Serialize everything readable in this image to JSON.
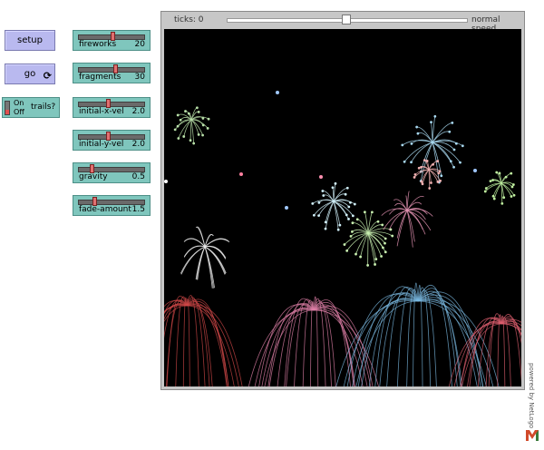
{
  "buttons": {
    "setup": "setup",
    "go": "go",
    "go_forever_icon": "forever-arrows-icon"
  },
  "switch": {
    "label": "trails?",
    "on_text": "On",
    "off_text": "Off",
    "state": "off"
  },
  "sliders": [
    {
      "name": "fireworks",
      "value": "20",
      "fraction": 0.5
    },
    {
      "name": "fragments",
      "value": "30",
      "fraction": 0.55
    },
    {
      "name": "initial-x-vel",
      "value": "2.0",
      "fraction": 0.43
    },
    {
      "name": "initial-y-vel",
      "value": "2.0",
      "fraction": 0.43
    },
    {
      "name": "gravity",
      "value": "0.5",
      "fraction": 0.18
    },
    {
      "name": "fade-amount",
      "value": "1.5",
      "fraction": 0.22
    }
  ],
  "view": {
    "ticks": "ticks: 0",
    "speed_label": "normal speed",
    "speed_fraction": 0.5
  },
  "footer": {
    "powered_by": "powered by NetLogo"
  },
  "colors": {
    "button_bg": "#b9b9ef",
    "widget_bg": "#7fc6bd",
    "view_bg": "#000000"
  }
}
